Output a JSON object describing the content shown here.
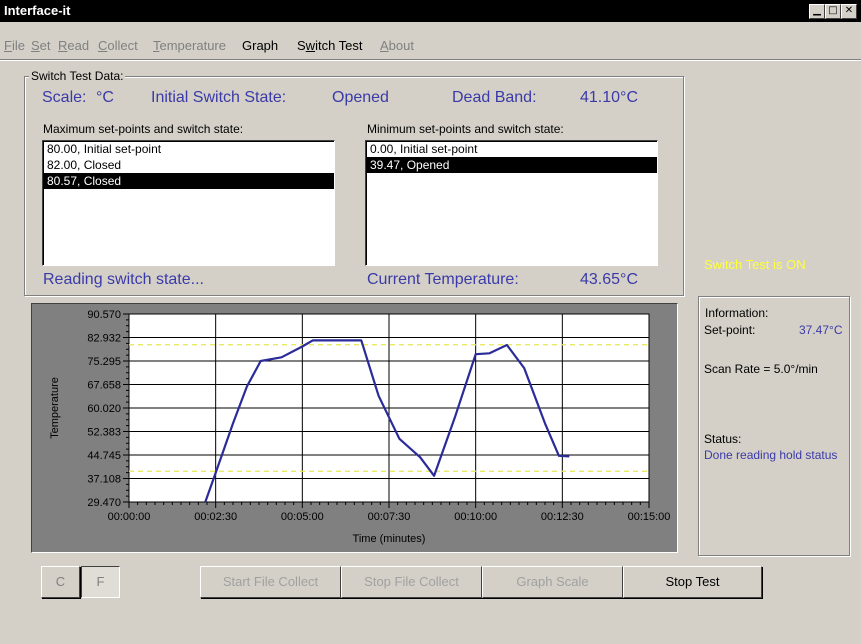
{
  "window": {
    "title": "Interface-it"
  },
  "menu": {
    "items": [
      {
        "label": "File",
        "ul": "F",
        "rest": "ile",
        "active": false
      },
      {
        "label": "Set",
        "ul": "S",
        "rest": "et",
        "active": false
      },
      {
        "label": "Read",
        "ul": "R",
        "rest": "ead",
        "active": false
      },
      {
        "label": "Collect",
        "ul": "C",
        "rest": "ollect",
        "active": false
      },
      {
        "label": "Temperature",
        "ul": "T",
        "rest": "emperature",
        "active": false
      },
      {
        "label": "Graph",
        "ul": "",
        "rest": "Graph",
        "active": true
      },
      {
        "label": "Switch Test",
        "pre": "S",
        "ul": "w",
        "rest": "itch Test",
        "active": true
      },
      {
        "label": "About",
        "ul": "A",
        "rest": "bout",
        "active": false
      }
    ]
  },
  "switch_test": {
    "group_label": "Switch Test Data:",
    "scale_label": "Scale:",
    "scale_value": "°C",
    "initial_state_label": "Initial Switch State:",
    "initial_state_value": "Opened",
    "dead_band_label": "Dead Band:",
    "dead_band_value": "41.10°C",
    "max_label": "Maximum set-points and switch state:",
    "min_label": "Minimum set-points and switch state:",
    "max_items": [
      "80.00, Initial set-point",
      "82.00, Closed",
      "80.57, Closed"
    ],
    "max_selected": 2,
    "min_items": [
      "0.00, Initial set-point",
      "39.47, Opened"
    ],
    "min_selected": 1,
    "status_text": "Reading switch state...",
    "current_temp_label": "Current Temperature:",
    "current_temp_value": "43.65°C",
    "switch_on_text": "Switch Test is ON"
  },
  "information": {
    "group_label": "Information:",
    "setpoint_label": "Set-point:",
    "setpoint_value": "37.47°C",
    "scan_rate": "Scan Rate = 5.0°/min",
    "status_label": "Status:",
    "status_value": "Done reading hold status"
  },
  "buttons": {
    "c_label": "C",
    "f_label": "F",
    "start_collect": "Start File Collect",
    "stop_collect": "Stop File Collect",
    "graph_scale": "Graph Scale",
    "stop_test": "Stop Test"
  },
  "colors": {
    "plot_line": "#2b2b9a",
    "threshold": "#e8e850",
    "blue_text": "#3a3aa8",
    "switch_on": "#ffff3a"
  },
  "chart_data": {
    "type": "line",
    "xlabel": "Time (minutes)",
    "ylabel": "Temperature",
    "x_ticks": [
      "00:00:00",
      "00:02:30",
      "00:05:00",
      "00:07:30",
      "00:10:00",
      "00:12:30",
      "00:15:00"
    ],
    "y_ticks": [
      "29.470",
      "37.108",
      "44.745",
      "52.383",
      "60.020",
      "67.658",
      "75.295",
      "82.932",
      "90.570"
    ],
    "xlim": [
      0,
      15
    ],
    "ylim": [
      29.47,
      90.57
    ],
    "grid": true,
    "thresholds": [
      80.57,
      39.47
    ],
    "series": [
      {
        "x": [
          2.2,
          2.5,
          3.0,
          3.4,
          3.8,
          4.4,
          5.0,
          5.3,
          6.1,
          6.7,
          7.2,
          7.8,
          8.4,
          8.8,
          9.4,
          10.0,
          10.4,
          10.9,
          11.4,
          12.0,
          12.4,
          12.7
        ],
        "y": [
          29.47,
          39.0,
          55.0,
          67.0,
          75.3,
          76.5,
          80.0,
          82.0,
          82.0,
          82.0,
          64.0,
          50.0,
          44.0,
          38.0,
          57.0,
          77.5,
          77.8,
          80.5,
          73.0,
          55.0,
          44.5,
          44.3
        ]
      }
    ]
  }
}
